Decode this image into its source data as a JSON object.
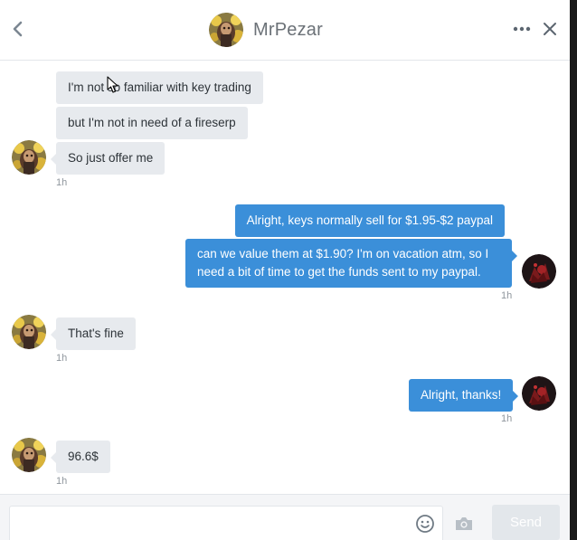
{
  "header": {
    "title": "MrPezar",
    "back_icon": "chevron-left-icon",
    "more_icon": "more-horizontal-icon",
    "close_icon": "close-icon"
  },
  "messages": [
    {
      "direction": "in",
      "text": "I'm not so familiar with key trading"
    },
    {
      "direction": "in",
      "text": "but I'm not in need of a fireserp"
    },
    {
      "direction": "in",
      "text": "So just offer me",
      "time": "1h"
    },
    {
      "direction": "out",
      "text": "Alright, keys normally sell for $1.95-$2 paypal"
    },
    {
      "direction": "out",
      "lines": [
        "can we value them at $1.90? I'm on vacation atm, so I",
        "need a bit of time to get the funds sent to my paypal."
      ],
      "time": "1h"
    },
    {
      "direction": "in",
      "text": "That's fine",
      "time": "1h"
    },
    {
      "direction": "out",
      "text": "Alright, thanks!",
      "time": "1h"
    },
    {
      "direction": "in",
      "text": "96.6$",
      "time": "1h"
    }
  ],
  "composer": {
    "placeholder": "",
    "send_label": "Send",
    "emoji_icon": "smiley-icon",
    "camera_icon": "camera-icon"
  },
  "colors": {
    "outgoing_bubble": "#3b8fd9",
    "incoming_bubble": "#e7eaee",
    "header_text": "#6b7177",
    "timestamp": "#8f969d"
  }
}
